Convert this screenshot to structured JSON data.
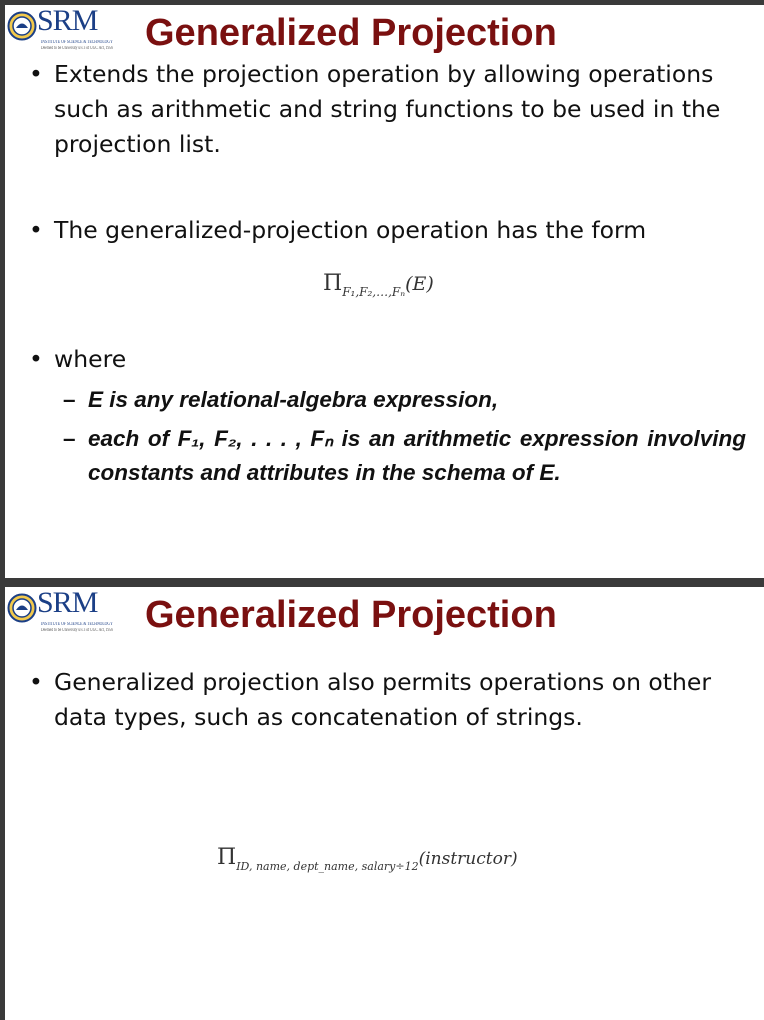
{
  "logo_text": "SRM",
  "logo_subtext": [
    "INSTITUTE OF SCIENCE & TECHNOLOGY",
    "Deemed to be University u/s 3 of UGC Act, 1956"
  ],
  "slides": [
    {
      "title": "Generalized Projection",
      "bullets": [
        "Extends the projection operation by allowing operations such as arithmetic and string functions to be used in the projection list.",
        "The generalized-projection operation has the form",
        "where"
      ],
      "formula": {
        "symbol": "Π",
        "subscript": "F₁,F₂,…,Fₙ",
        "argument": "(E)"
      },
      "sub_items": [
        "E is any relational-algebra expression,",
        "each of F₁, F₂, . . . , Fₙ is an arithmetic expression involving constants and attributes in the schema of E."
      ],
      "dash": "–"
    },
    {
      "title": "Generalized Projection",
      "bullets": [
        "Generalized projection also permits operations on other data types, such as concatenation of strings."
      ],
      "formula": {
        "symbol": "Π",
        "subscript": "ID, name, dept_name, salary÷12",
        "argument": "(instructor)"
      }
    }
  ],
  "bullet_char": "•",
  "colors": {
    "title": "#7a1010",
    "logo": "#1b3f86",
    "text": "#111111"
  }
}
